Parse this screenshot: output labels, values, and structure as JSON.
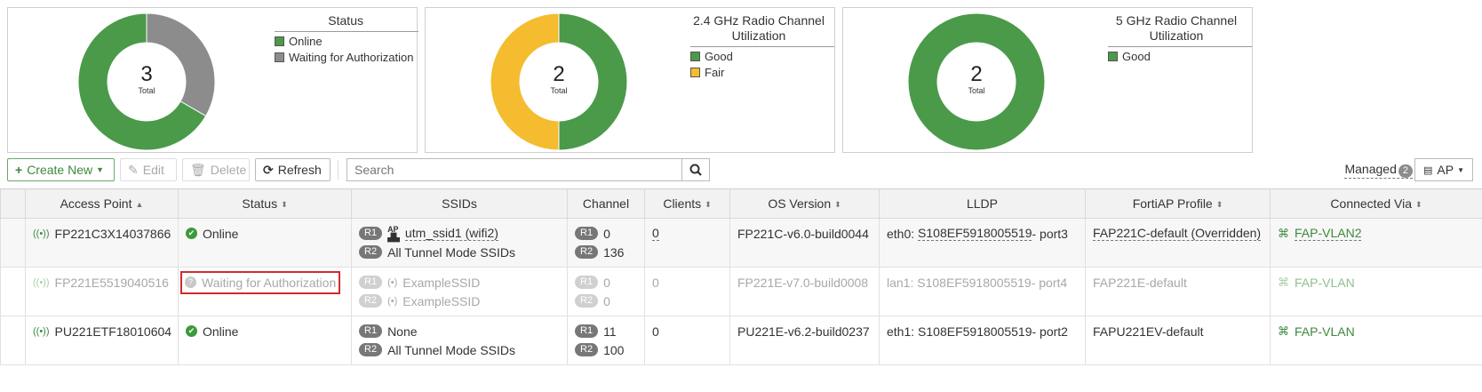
{
  "widgets": {
    "status": {
      "title": "Status",
      "total": "3",
      "total_label": "Total",
      "legend": [
        {
          "label": "Online",
          "color": "#4a9a4a"
        },
        {
          "label": "Waiting for Authorization",
          "color": "#8c8c8c"
        }
      ],
      "segments": [
        {
          "label": "Online",
          "value": 2
        },
        {
          "label": "Waiting for Authorization",
          "value": 1
        }
      ]
    },
    "radio24": {
      "title_line1": "2.4 GHz Radio Channel",
      "title_line2": "Utilization",
      "total": "2",
      "total_label": "Total",
      "legend": [
        {
          "label": "Good",
          "color": "#4a9a4a"
        },
        {
          "label": "Fair",
          "color": "#f4bc2e"
        }
      ],
      "segments": [
        {
          "label": "Good",
          "value": 1
        },
        {
          "label": "Fair",
          "value": 1
        }
      ]
    },
    "radio5": {
      "title_line1": "5 GHz Radio Channel",
      "title_line2": "Utilization",
      "total": "2",
      "total_label": "Total",
      "legend": [
        {
          "label": "Good",
          "color": "#4a9a4a"
        }
      ],
      "segments": [
        {
          "label": "Good",
          "value": 2
        }
      ]
    }
  },
  "toolbar": {
    "create_label": "Create New",
    "edit_label": "Edit",
    "delete_label": "Delete",
    "refresh_label": "Refresh",
    "search_placeholder": "Search",
    "managed_label": "Managed",
    "managed_count": "2",
    "view_label": "AP"
  },
  "table": {
    "columns": [
      "Access Point",
      "Status",
      "SSIDs",
      "Channel",
      "Clients",
      "OS Version",
      "LLDP",
      "FortiAP Profile",
      "Connected Via"
    ],
    "rows": [
      {
        "access_point": "FP221C3X14037866",
        "status": "Online",
        "ssid_r1": "utm_ssid1 (wifi2)",
        "ssid_r2": "All Tunnel Mode SSIDs",
        "r1": "R1",
        "r2": "R2",
        "chan_r1": "0",
        "chan_r2": "136",
        "clients": "0",
        "os": "FP221C-v6.0-build0044",
        "lldp_prefix": "eth0: ",
        "lldp_switch": "S108EF5918005519",
        "lldp_suffix": " - port3",
        "profile": "FAP221C-default (Overridden)",
        "connected": "FAP-VLAN2"
      },
      {
        "access_point": "FP221E5519040516",
        "status": "Waiting for Authorization",
        "ssid_r1": "ExampleSSID",
        "ssid_r2": "ExampleSSID",
        "r1": "R1",
        "r2": "R2",
        "chan_r1": "0",
        "chan_r2": "0",
        "clients": "0",
        "os": "FP221E-v7.0-build0008",
        "lldp_prefix": "lan1: ",
        "lldp_switch": "S108EF5918005519",
        "lldp_suffix": " - port4",
        "profile": "FAP221E-default",
        "connected": "FAP-VLAN"
      },
      {
        "access_point": "PU221ETF18010604",
        "status": "Online",
        "ssid_r1": "None",
        "ssid_r2": "All Tunnel Mode SSIDs",
        "r1": "R1",
        "r2": "R2",
        "chan_r1": "11",
        "chan_r2": "100",
        "clients": "0",
        "os": "PU221E-v6.2-build0237",
        "lldp_prefix": "eth1: ",
        "lldp_switch": "S108EF5918005519",
        "lldp_suffix": " - port2",
        "profile": "FAPU221EV-default",
        "connected": "FAP-VLAN"
      }
    ]
  },
  "colors": {
    "green": "#4a9a4a",
    "gray": "#8c8c8c",
    "yellow": "#f4bc2e",
    "highlight_border": "#d42a2a"
  }
}
